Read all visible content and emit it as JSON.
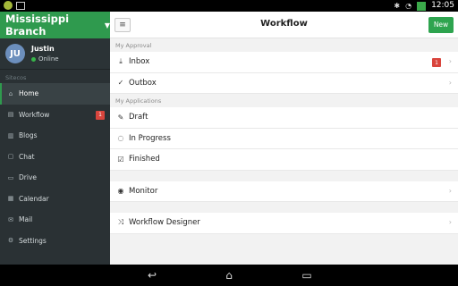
{
  "statusbar": {
    "time": "12:05",
    "icons": [
      "wifi-icon",
      "battery-icon"
    ]
  },
  "sidebar": {
    "branch": "Mississippi Branch",
    "user": {
      "initials": "JU",
      "name": "Justin",
      "status": "Online"
    },
    "section_label": "Sitecos",
    "items": [
      {
        "label": "Home",
        "icon": "home-icon"
      },
      {
        "label": "Workflow",
        "icon": "workflow-icon",
        "badge": "1"
      },
      {
        "label": "Blogs",
        "icon": "blogs-icon"
      },
      {
        "label": "Chat",
        "icon": "chat-icon"
      },
      {
        "label": "Drive",
        "icon": "drive-icon"
      },
      {
        "label": "Calendar",
        "icon": "calendar-icon"
      },
      {
        "label": "Mail",
        "icon": "mail-icon"
      },
      {
        "label": "Settings",
        "icon": "settings-icon"
      }
    ]
  },
  "main": {
    "title": "Workflow",
    "new_label": "New",
    "approval": {
      "label": "My Approval",
      "items": [
        {
          "label": "Inbox",
          "icon": "inbox-icon",
          "badge": "1"
        },
        {
          "label": "Outbox",
          "icon": "outbox-icon"
        }
      ]
    },
    "applications": {
      "label": "My Applications",
      "items": [
        {
          "label": "Draft",
          "icon": "draft-icon"
        },
        {
          "label": "In Progress",
          "icon": "progress-icon"
        },
        {
          "label": "Finished",
          "icon": "finished-icon"
        }
      ]
    },
    "monitor": {
      "label": "Monitor",
      "icon": "eye-icon"
    },
    "designer": {
      "label": "Workflow Designer",
      "icon": "shuffle-icon"
    }
  },
  "colors": {
    "accent": "#2f9a4e",
    "sidebar_bg": "#2a3134",
    "badge": "#d9453d",
    "new_button": "#2ea44f"
  }
}
